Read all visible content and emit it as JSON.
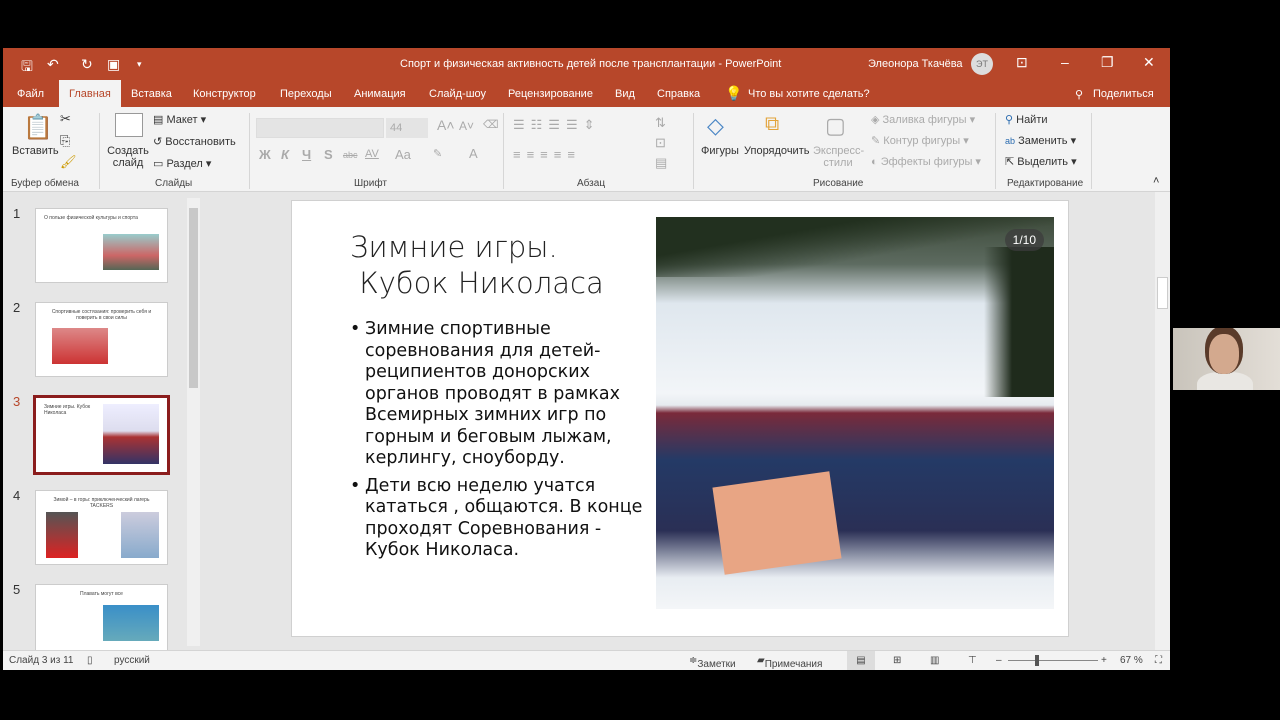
{
  "window": {
    "title": "Спорт и физическая активность детей после трансплантации  -  PowerPoint",
    "user": "Элеонора Ткачёва",
    "user_initials": "ЭТ"
  },
  "tabs": [
    "Файл",
    "Главная",
    "Вставка",
    "Конструктор",
    "Переходы",
    "Анимация",
    "Слайд-шоу",
    "Рецензирование",
    "Вид",
    "Справка"
  ],
  "tell_me": "Что вы хотите сделать?",
  "share": "Поделиться",
  "ribbon": {
    "clipboard": {
      "paste": "Вставить",
      "group": "Буфер обмена"
    },
    "slides": {
      "new_slide": "Создать слайд",
      "layout": "Макет",
      "reset": "Восстановить",
      "section": "Раздел",
      "group": "Слайды"
    },
    "font": {
      "size": "44",
      "bold": "Ж",
      "italic": "К",
      "underline": "Ч",
      "strike": "S",
      "abc": "abc",
      "spacing": "AV",
      "case": "Aa",
      "group": "Шрифт"
    },
    "paragraph": {
      "group": "Абзац"
    },
    "drawing": {
      "shapes": "Фигуры",
      "arrange": "Упорядочить",
      "quick_styles": "Экспресс-стили",
      "fill": "Заливка фигуры",
      "outline": "Контур фигуры",
      "effects": "Эффекты фигуры",
      "group": "Рисование"
    },
    "editing": {
      "find": "Найти",
      "replace": "Заменить",
      "select": "Выделить",
      "group": "Редактирование"
    }
  },
  "thumbnails": [
    {
      "num": "1",
      "title": "О пользе физической культуры и спорта"
    },
    {
      "num": "2",
      "title": "Спортивные состязания: проверить себя и поверить в свои силы"
    },
    {
      "num": "3",
      "title": "Зимние игры. Кубок Николаса"
    },
    {
      "num": "4",
      "title": "Зимой – в горы: приключенческий лагерь TACKERS"
    },
    {
      "num": "5",
      "title": "Плавать могут все"
    }
  ],
  "slide": {
    "title_line1": "Зимние игры.",
    "title_line2": " Кубок Николаса",
    "bullets": [
      "Зимние спортивные соревнования для детей-реципиентов донорских органов проводят в рамках Всемирных зимних игр по горным и беговым лыжам, керлингу, сноуборду.",
      "Дети всю неделю учатся кататься , общаются. В конце проходят Соревнования - Кубок Николаса."
    ],
    "photo_counter": "1/10"
  },
  "status": {
    "slide": "Слайд 3 из 11",
    "language": "русский",
    "notes": "Заметки",
    "comments": "Примечания",
    "zoom": "67 %"
  },
  "colors": {
    "accent": "#b7472a",
    "selected_thumb": "#8b1d1d"
  }
}
